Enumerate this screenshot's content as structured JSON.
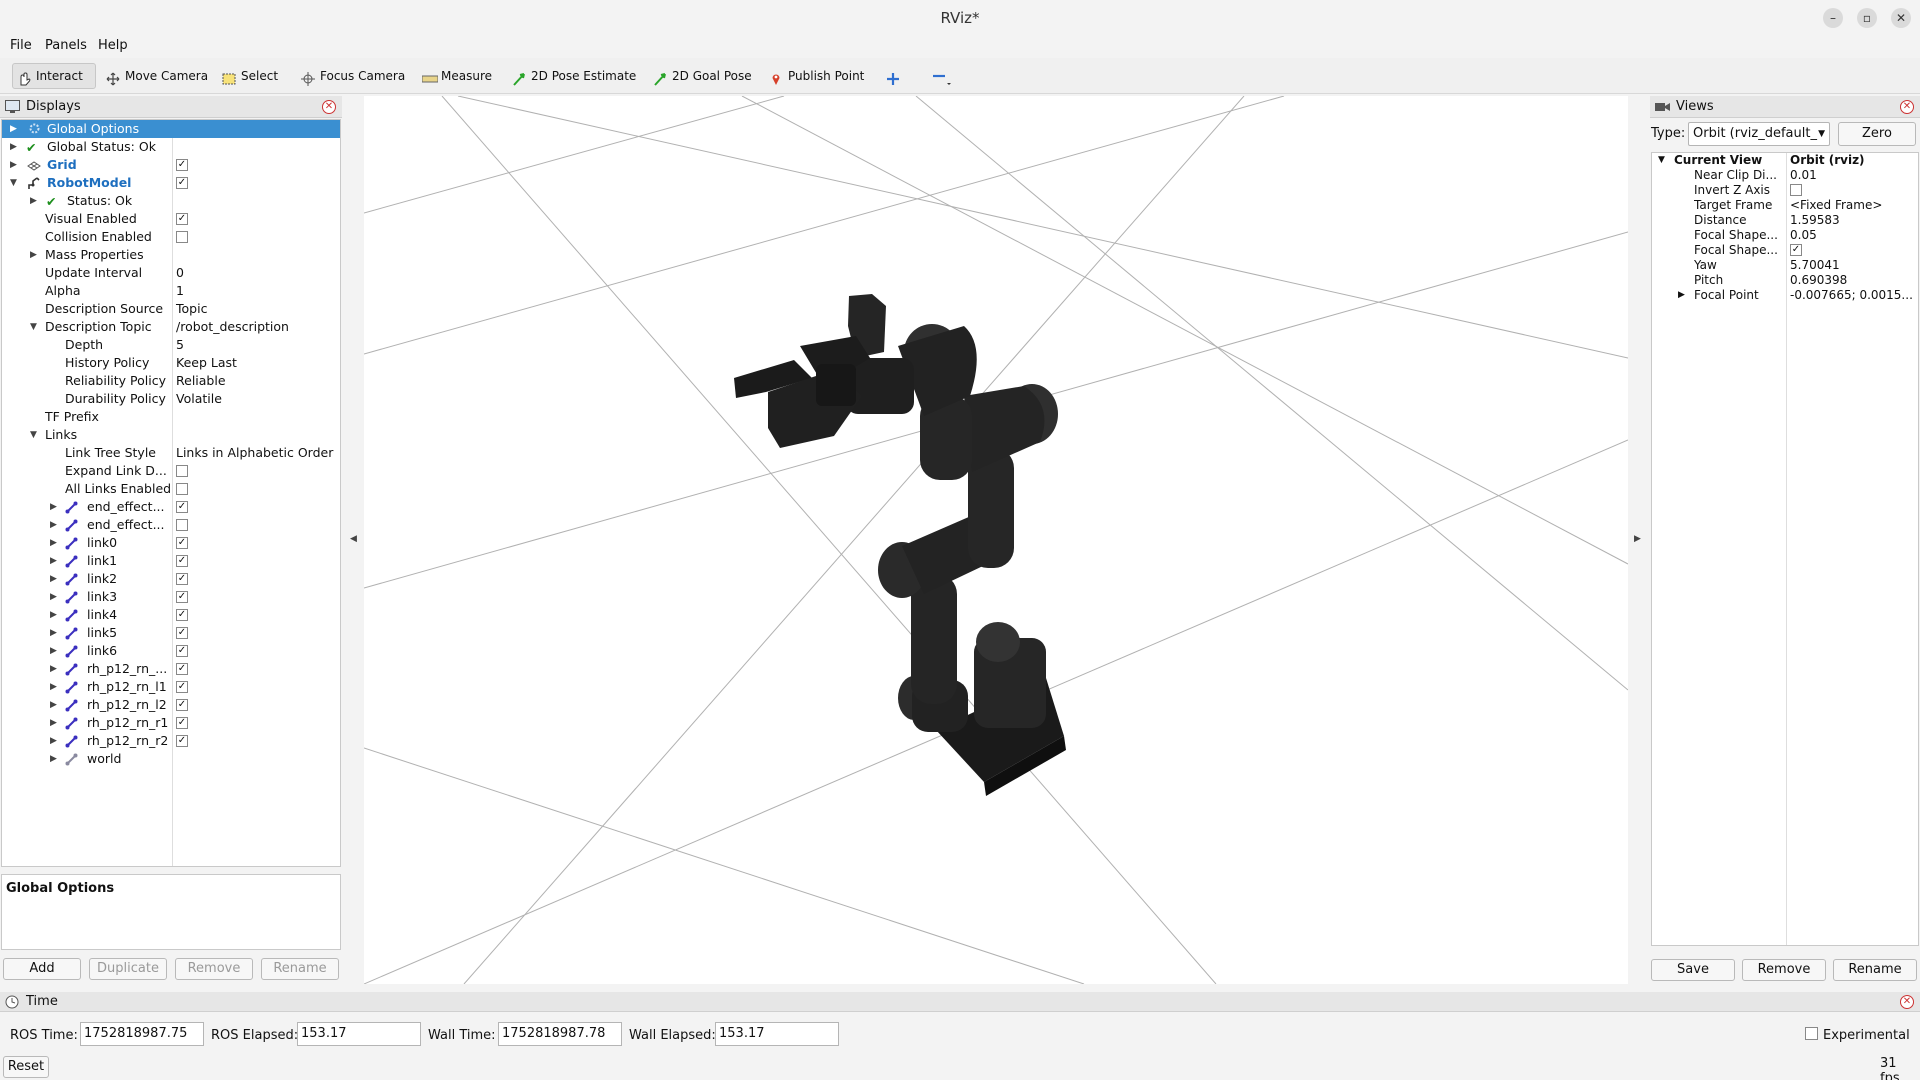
{
  "window": {
    "title": "RViz*",
    "minimize": "–",
    "maximize": "▫",
    "close": "✕"
  },
  "menu": {
    "file": "File",
    "panels": "Panels",
    "help": "Help"
  },
  "toolbar": {
    "interact": "Interact",
    "move_camera": "Move Camera",
    "select": "Select",
    "focus_camera": "Focus Camera",
    "measure": "Measure",
    "pose_estimate": "2D Pose Estimate",
    "goal_pose": "2D Goal Pose",
    "publish_point": "Publish Point"
  },
  "displays": {
    "title": "Displays",
    "rows": {
      "global_options": "Global Options",
      "global_status": "Global Status: Ok",
      "grid": "Grid",
      "robot_model": "RobotModel",
      "status": "Status: Ok",
      "visual_enabled": "Visual Enabled",
      "collision_enabled": "Collision Enabled",
      "mass_properties": "Mass Properties",
      "update_interval": "Update Interval",
      "update_interval_val": "0",
      "alpha": "Alpha",
      "alpha_val": "1",
      "description_source": "Description Source",
      "description_source_val": "Topic",
      "description_topic": "Description Topic",
      "description_topic_val": "/robot_description",
      "depth": "Depth",
      "depth_val": "5",
      "history_policy": "History Policy",
      "history_policy_val": "Keep Last",
      "reliability_policy": "Reliability Policy",
      "reliability_policy_val": "Reliable",
      "durability_policy": "Durability Policy",
      "durability_policy_val": "Volatile",
      "tf_prefix": "TF Prefix",
      "links": "Links",
      "link_tree_style": "Link Tree Style",
      "link_tree_style_val": "Links in Alphabetic Order",
      "expand_link": "Expand Link D...",
      "all_links_enabled": "All Links Enabled"
    },
    "link_items": [
      "end_effect...",
      "end_effect...",
      "link0",
      "link1",
      "link2",
      "link3",
      "link4",
      "link5",
      "link6",
      "rh_p12_rn_...",
      "rh_p12_rn_l1",
      "rh_p12_rn_l2",
      "rh_p12_rn_r1",
      "rh_p12_rn_r2",
      "world"
    ],
    "description_title": "Global Options",
    "buttons": {
      "add": "Add",
      "duplicate": "Duplicate",
      "remove": "Remove",
      "rename": "Rename"
    }
  },
  "views": {
    "title": "Views",
    "type_label": "Type:",
    "type_value": "Orbit (rviz_default_",
    "zero": "Zero",
    "current_view": "Current View",
    "current_view_val": "Orbit (rviz)",
    "props": {
      "near_clip": "Near Clip Di...",
      "near_clip_val": "0.01",
      "invert_z": "Invert Z Axis",
      "target_frame": "Target Frame",
      "target_frame_val": "<Fixed Frame>",
      "distance": "Distance",
      "distance_val": "1.59583",
      "focal_size": "Focal Shape...",
      "focal_size_val": "0.05",
      "focal_fixed": "Focal Shape...",
      "yaw": "Yaw",
      "yaw_val": "5.70041",
      "pitch": "Pitch",
      "pitch_val": "0.690398",
      "focal_point": "Focal Point",
      "focal_point_val": "-0.007665; 0.0015..."
    },
    "buttons": {
      "save": "Save",
      "remove": "Remove",
      "rename": "Rename"
    }
  },
  "time": {
    "title": "Time",
    "ros_time_label": "ROS Time:",
    "ros_time": "1752818987.75",
    "ros_elapsed_label": "ROS Elapsed:",
    "ros_elapsed": "153.17",
    "wall_time_label": "Wall Time:",
    "wall_time": "1752818987.78",
    "wall_elapsed_label": "Wall Elapsed:",
    "wall_elapsed": "153.17",
    "experimental": "Experimental",
    "reset": "Reset",
    "fps": "31 fps"
  },
  "colors": {
    "selection": "#3a8fd1",
    "robot": "#1c1c1c",
    "grid": "#a8a8a8"
  }
}
